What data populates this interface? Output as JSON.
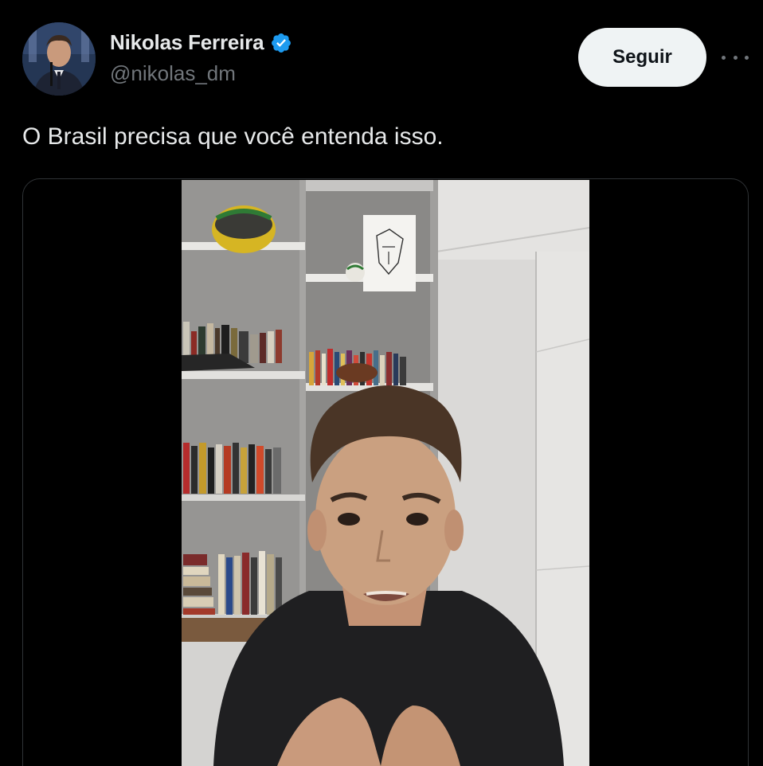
{
  "author": {
    "display_name": "Nikolas Ferreira",
    "handle": "@nikolas_dm",
    "verified": true,
    "avatar_icon": "profile-photo"
  },
  "actions": {
    "follow_label": "Seguir",
    "more_icon": "more-horizontal-icon"
  },
  "post": {
    "text": "O Brasil precisa que você entenda isso."
  },
  "media": {
    "type": "video"
  },
  "colors": {
    "background": "#000000",
    "text_primary": "#e7e9ea",
    "text_secondary": "#71767b",
    "verified_blue": "#1d9bf0",
    "follow_button_bg": "#eff3f4",
    "border": "#2f3336"
  }
}
